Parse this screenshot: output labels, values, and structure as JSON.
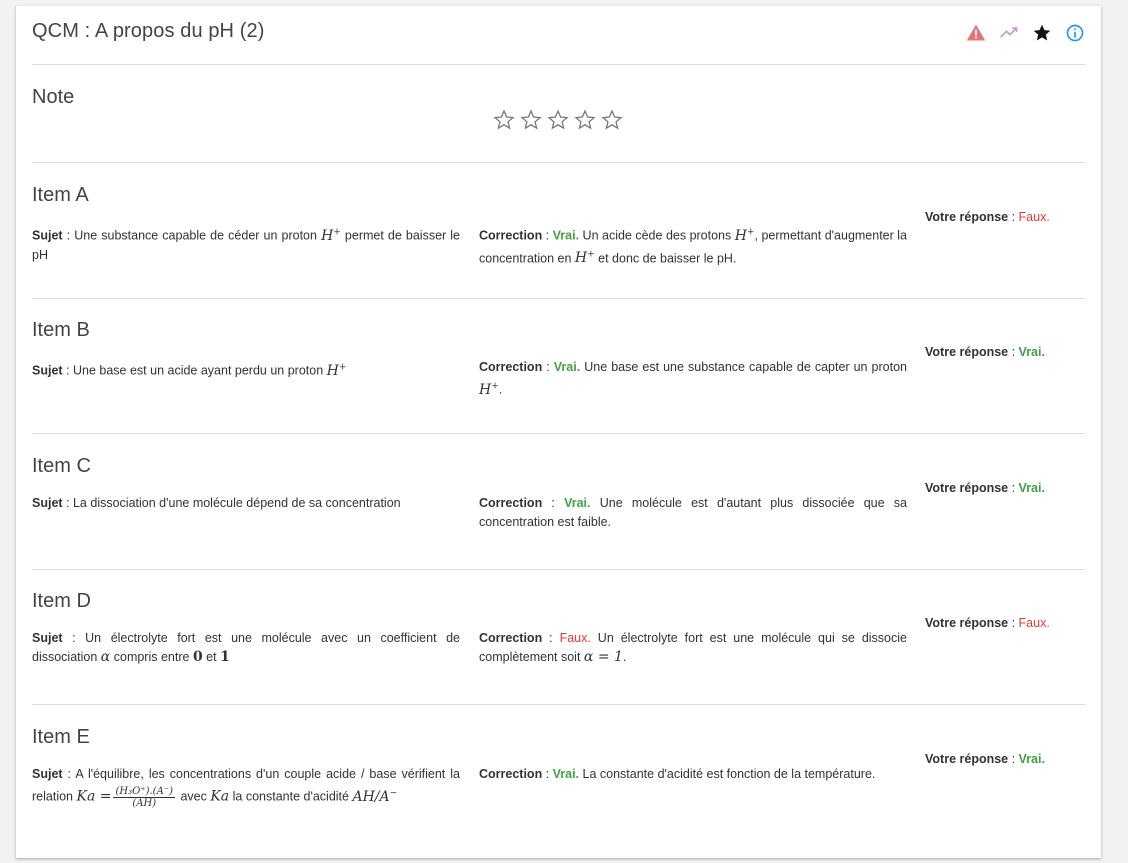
{
  "header": {
    "title": "QCM : A propos du pH (2)",
    "icons": [
      "warning-icon",
      "trending-up-icon",
      "star-icon",
      "info-icon"
    ],
    "colors": {
      "warning": "#e57373",
      "trend": "#ce93d8",
      "star": "#111111",
      "info": "#2196f3"
    }
  },
  "note": {
    "title": "Note",
    "rating": 0,
    "max_rating": 5
  },
  "labels": {
    "sujet": "Sujet",
    "correction": "Correction",
    "votre_reponse": "Votre réponse",
    "sep": " : "
  },
  "items": [
    {
      "title": "Item A",
      "sujet_pre": "Une substance capable de céder un proton ",
      "sujet_math": "H",
      "sujet_post": " permet de baisser le pH",
      "correction_verdict": "Vrai.",
      "correction_pre": " Un acide cède des protons ",
      "correction_mid": ", permettant d'augmenter la concentration en ",
      "correction_post": " et donc de baisser le pH.",
      "reponse": "Faux."
    },
    {
      "title": "Item B",
      "sujet_pre": "Une base est un acide ayant perdu un proton ",
      "correction_verdict": "Vrai.",
      "correction_pre": " Une base est une substance capable de capter un proton ",
      "correction_post": ".",
      "reponse": "Vrai."
    },
    {
      "title": "Item C",
      "sujet_pre": "La dissociation d'une molécule dépend de sa concentration",
      "correction_verdict": "Vrai.",
      "correction_pre": " Une molécule est d'autant plus dissociée que sa concentration est faible.",
      "reponse": "Vrai."
    },
    {
      "title": "Item D",
      "sujet_pre": "Un électrolyte fort est une molécule avec un coefficient de dissociation ",
      "sujet_alpha": "α",
      "sujet_mid": " compris entre ",
      "sujet_zero": "0",
      "sujet_et": " et ",
      "sujet_one": "1",
      "correction_verdict": "Faux.",
      "correction_pre": " Un électrolyte fort est une molécule qui se dissocie complètement soit ",
      "correction_math": "α = 1",
      "correction_post": ".",
      "reponse": "Faux."
    },
    {
      "title": "Item E",
      "sujet_pre": "A l'équilibre, les concentrations d'un couple acide / base vérifient la relation ",
      "sujet_ka": "Ka =",
      "frac_num": "(H₃O⁺).(A⁻)",
      "frac_den": "(AH)",
      "sujet_mid": " avec ",
      "sujet_ka2": "Ka",
      "sujet_post": " la constante d'acidité ",
      "sujet_math_end": "AH/A",
      "correction_verdict": "Vrai.",
      "correction_pre": " La constante d'acidité est fonction de la température.",
      "reponse": "Vrai."
    }
  ]
}
